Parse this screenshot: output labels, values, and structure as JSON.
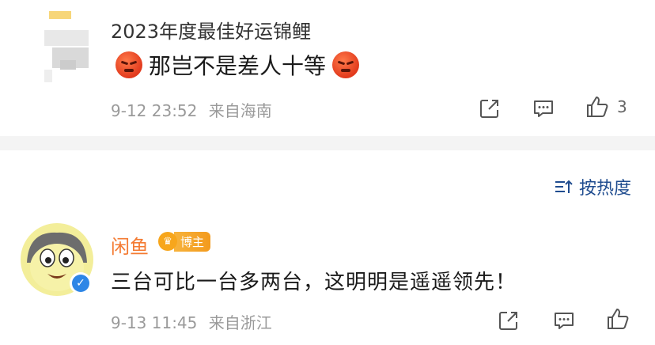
{
  "comment1": {
    "username": "2023年度最佳好运锦鲤",
    "text": "那岂不是差人十等",
    "date": "9-12 23:52",
    "location": "来自海南",
    "like_count": "3"
  },
  "sort": {
    "label": "按热度"
  },
  "comment2": {
    "username": "闲鱼",
    "badge": "博主",
    "text": "三台可比一台多两台，这明明是遥遥领先！",
    "date": "9-13 11:45",
    "location": "来自浙江"
  },
  "icons": {
    "share": "share-icon",
    "comment": "comment-icon",
    "like": "thumbs-up-icon",
    "sort": "sort-icon",
    "verified": "verified-icon",
    "crown": "crown-icon",
    "emoji": "angry-face-icon"
  },
  "colors": {
    "username_highlight": "#f47a31",
    "link_blue": "#1f4c8f",
    "meta_gray": "#9a9a9a"
  }
}
